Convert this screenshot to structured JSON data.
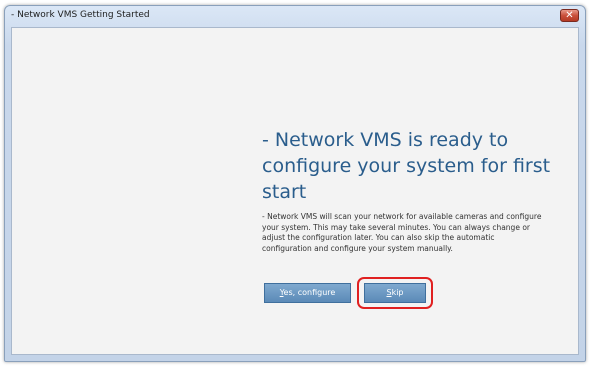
{
  "window": {
    "title": "- Network VMS Getting Started",
    "close_glyph": "✕"
  },
  "main": {
    "heading": "- Network VMS is ready to configure your system for first start",
    "description": "- Network VMS will scan your network for available cameras and configure your system. This may take several minutes. You can always change or adjust the configuration later. You can also skip the automatic configuration and configure your system manually."
  },
  "buttons": {
    "yes_mnemonic": "Y",
    "yes_rest": "es, configure",
    "skip_mnemonic": "S",
    "skip_rest": "kip"
  },
  "colors": {
    "heading": "#2a5d8c",
    "button": "#6d9bc6",
    "highlight": "#e02020"
  },
  "icons": {
    "close": "close-icon"
  }
}
